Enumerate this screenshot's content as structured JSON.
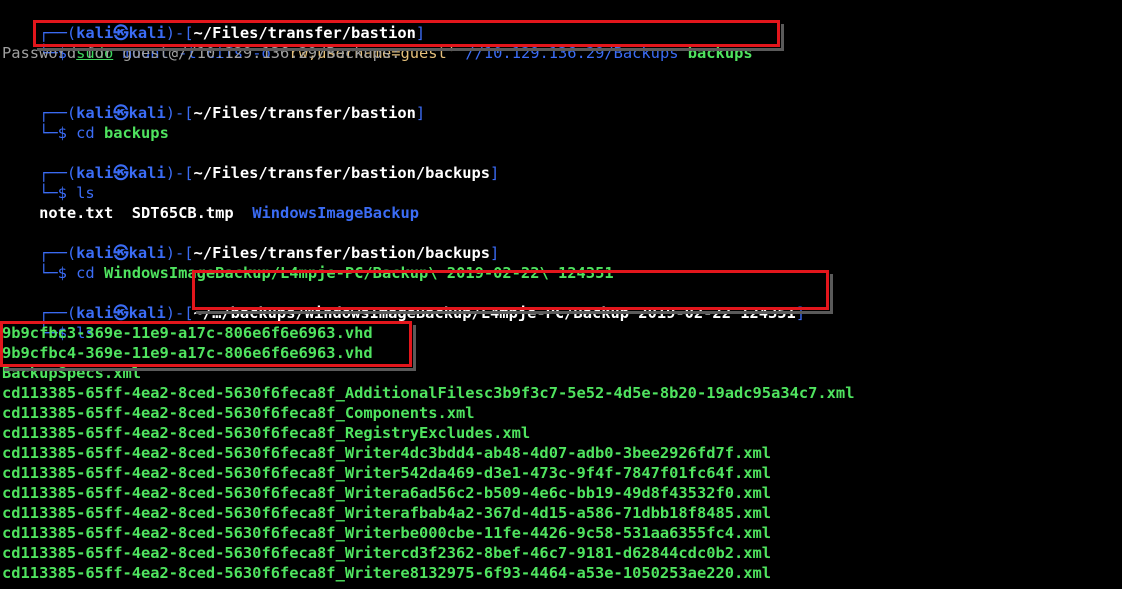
{
  "prompt": {
    "corner": "┌──(",
    "user": "kali",
    "skull": "㉿",
    "host": "kali",
    "sep": ")-[",
    "close": "]",
    "dollar": "└─$ "
  },
  "blocks": [
    {
      "path": "~/Files/transfer/bastion",
      "cmd_parts": [
        "sudo",
        " mount -t cifs -o ",
        "'rw,username=guest'",
        " //10.129.136.29/Backups ",
        "backups"
      ],
      "output": [
        "Password for guest@//10.129.136.29/Backups:"
      ]
    },
    {
      "path": "~/Files/transfer/bastion",
      "cmd": "cd ",
      "cmd_arg": "backups"
    },
    {
      "path": "~/Files/transfer/bastion/backups",
      "cmd": "ls",
      "ls_output": [
        "note.txt",
        "SDT65CB.tmp",
        "WindowsImageBackup"
      ]
    },
    {
      "path": "~/Files/transfer/bastion/backups",
      "cmd": "cd ",
      "cmd_arg": "WindowsImageBackup/L4mpje-PC/Backup\\ 2019-02-22\\ 124351"
    },
    {
      "path": "~/…/backups/WindowsImageBackup/L4mpje-PC/Backup 2019-02-22 124351",
      "cmd": "ls",
      "files": [
        "9b9cfbc3-369e-11e9-a17c-806e6f6e6963.vhd",
        "9b9cfbc4-369e-11e9-a17c-806e6f6e6963.vhd",
        "BackupSpecs.xml",
        "cd113385-65ff-4ea2-8ced-5630f6feca8f_AdditionalFilesc3b9f3c7-5e52-4d5e-8b20-19adc95a34c7.xml",
        "cd113385-65ff-4ea2-8ced-5630f6feca8f_Components.xml",
        "cd113385-65ff-4ea2-8ced-5630f6feca8f_RegistryExcludes.xml",
        "cd113385-65ff-4ea2-8ced-5630f6feca8f_Writer4dc3bdd4-ab48-4d07-adb0-3bee2926fd7f.xml",
        "cd113385-65ff-4ea2-8ced-5630f6feca8f_Writer542da469-d3e1-473c-9f4f-7847f01fc64f.xml",
        "cd113385-65ff-4ea2-8ced-5630f6feca8f_Writera6ad56c2-b509-4e6c-bb19-49d8f43532f0.xml",
        "cd113385-65ff-4ea2-8ced-5630f6feca8f_Writerafbab4a2-367d-4d15-a586-71dbb18f8485.xml",
        "cd113385-65ff-4ea2-8ced-5630f6feca8f_Writerbe000cbe-11fe-4426-9c58-531aa6355fc4.xml",
        "cd113385-65ff-4ea2-8ced-5630f6feca8f_Writercd3f2362-8bef-46c7-9181-d62844cdc0b2.xml",
        "cd113385-65ff-4ea2-8ced-5630f6feca8f_Writere8132975-6f93-4464-a53e-1050253ae220.xml"
      ]
    }
  ],
  "colors": {
    "prompt_blue": "#3b6cf5",
    "highlight_red": "#e3161c",
    "file_green": "#4fe35f"
  }
}
